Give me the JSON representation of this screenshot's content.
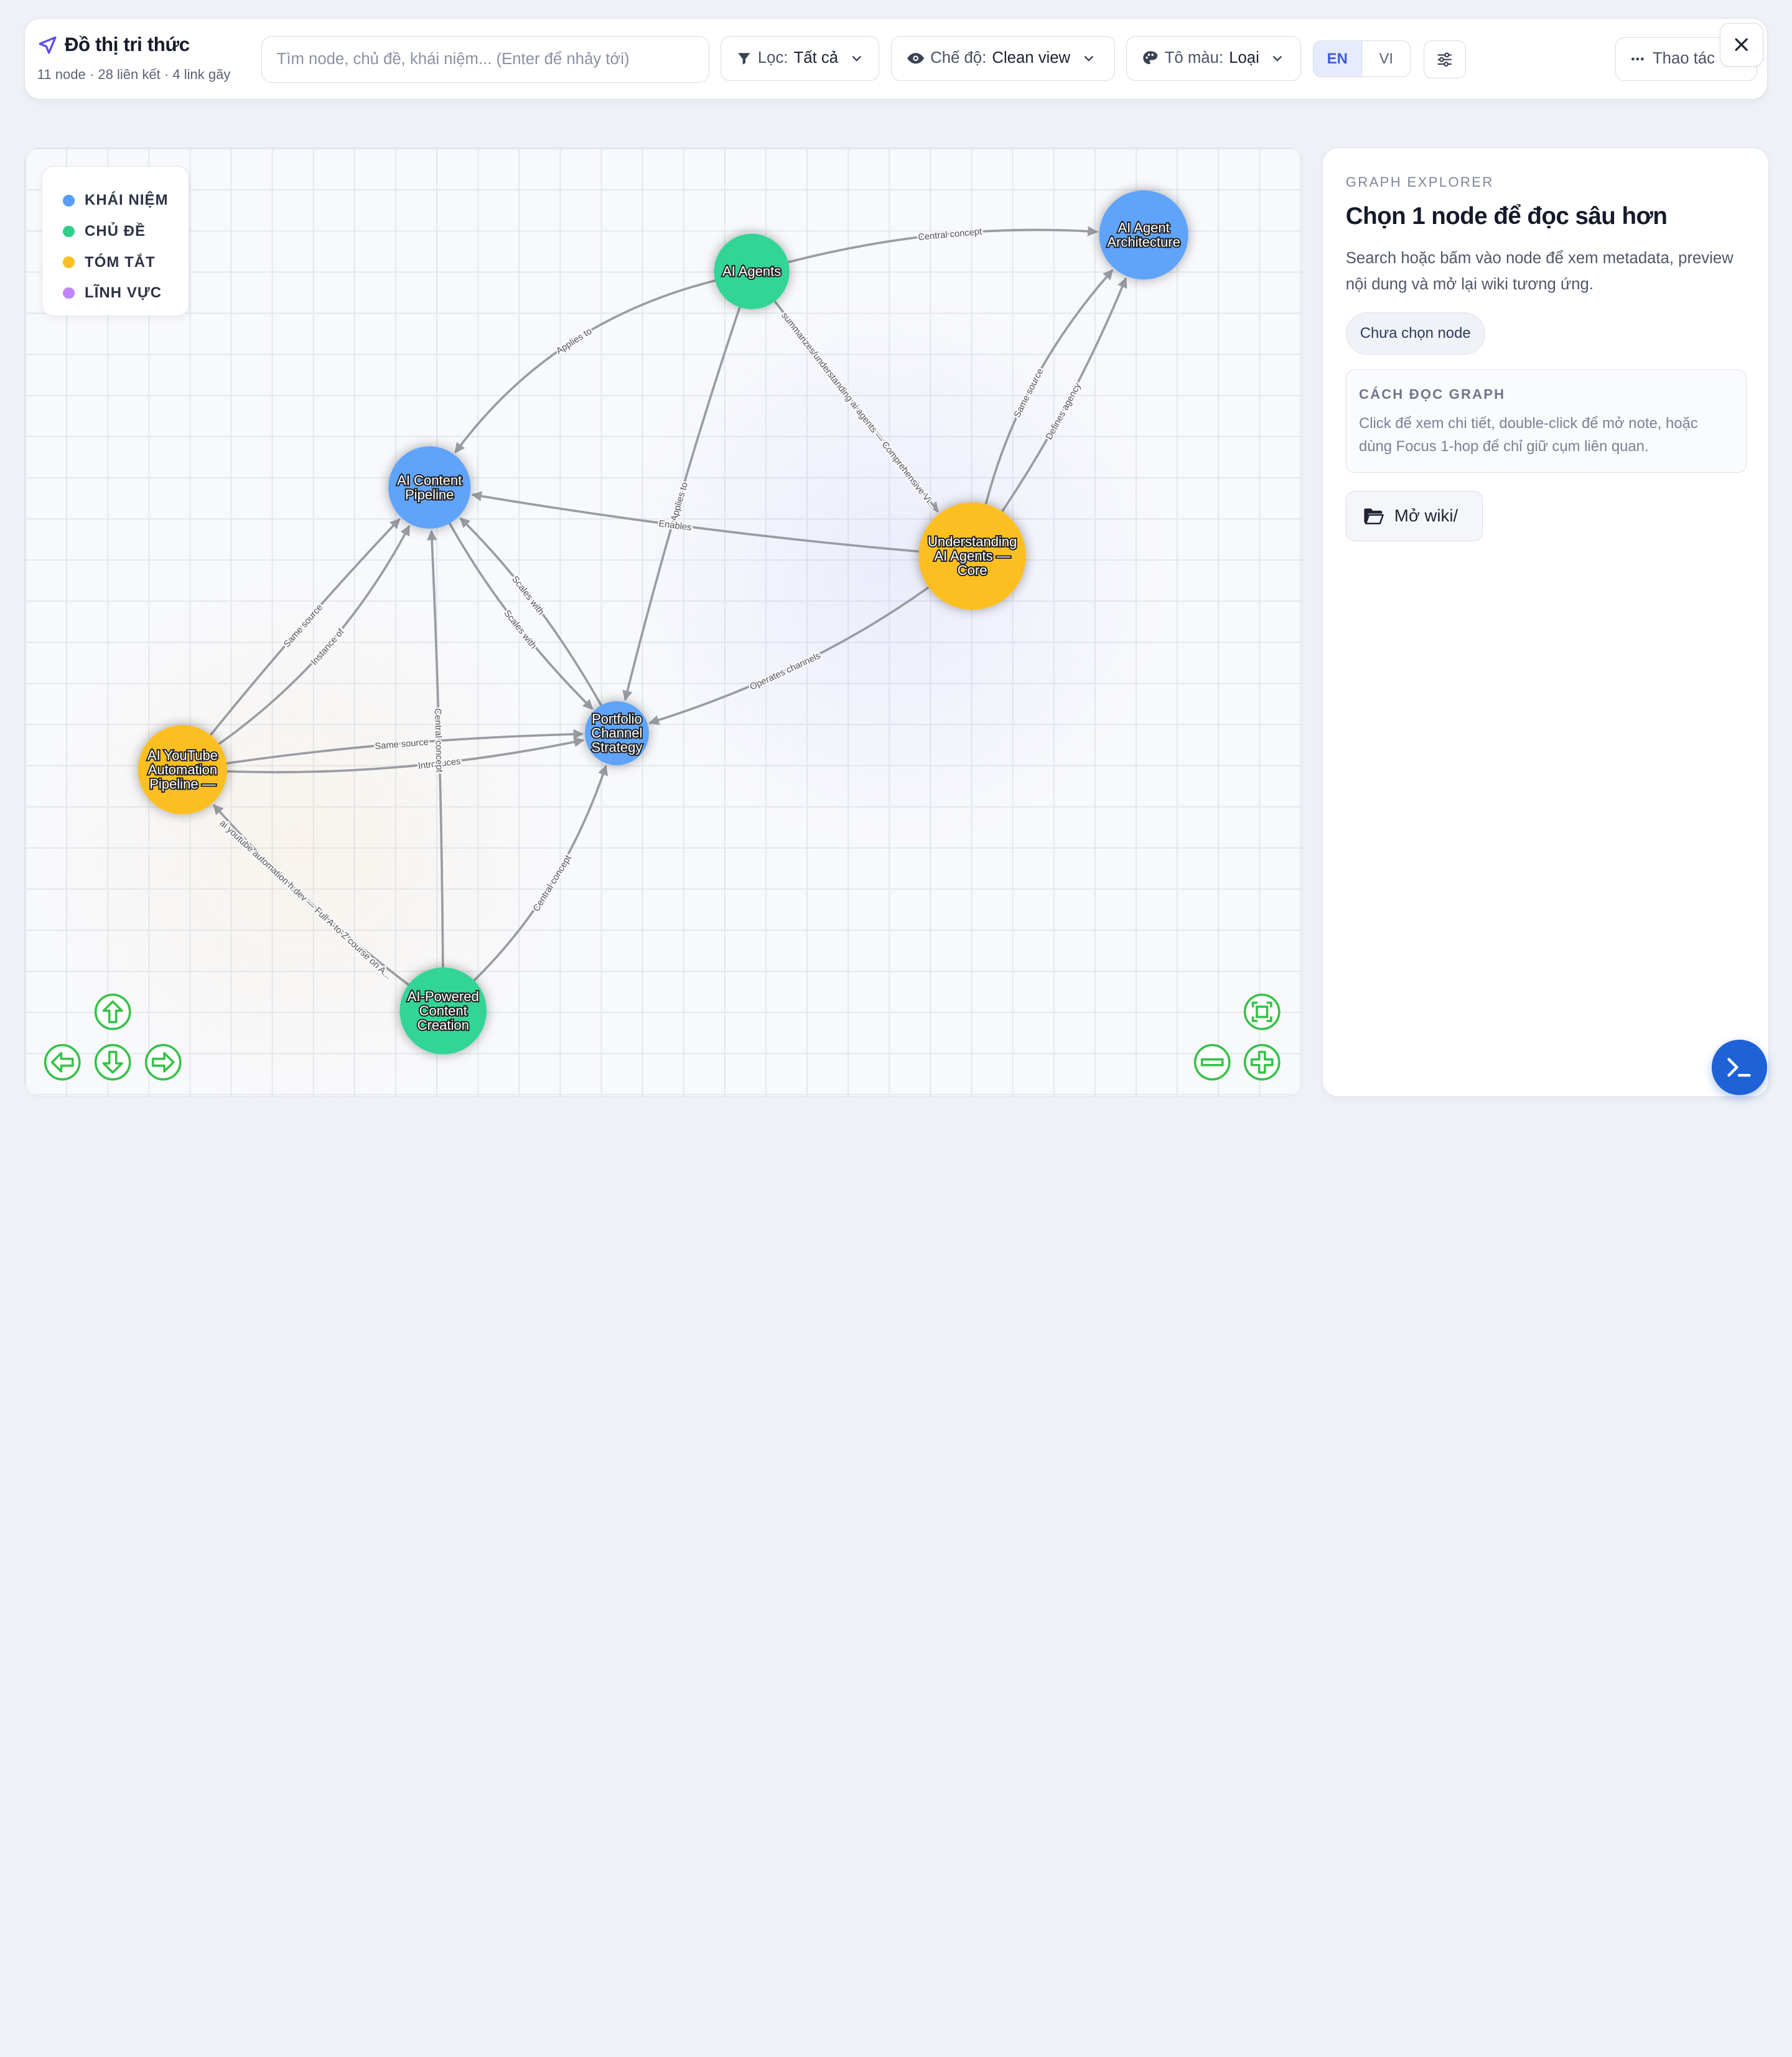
{
  "header": {
    "title": "Đồ thị tri thức",
    "stats": "11 node · 28 liên kết · 4 link gãy",
    "search_placeholder": "Tìm node, chủ đề, khái niệm... (Enter để nhảy tới)",
    "filter": {
      "label": "Lọc:",
      "value": "Tất cả"
    },
    "mode": {
      "label": "Chế độ:",
      "value": "Clean view"
    },
    "color": {
      "label": "Tô màu:",
      "value": "Loại"
    },
    "lang": {
      "en": "EN",
      "vi": "VI",
      "active": "EN"
    },
    "actions_label": "Thao tác"
  },
  "legend": [
    {
      "label": "KHÁI NIỆM",
      "color": "#5b9df6"
    },
    {
      "label": "CHỦ ĐỀ",
      "color": "#2fcf8b"
    },
    {
      "label": "TÓM TẮT",
      "color": "#fbbf24"
    },
    {
      "label": "LĨNH VỰC",
      "color": "#c084fc"
    }
  ],
  "graph": {
    "nodes": [
      {
        "id": "ai_agents",
        "lines": [
          "AI Agents"
        ],
        "type": "topic"
      },
      {
        "id": "arch",
        "lines": [
          "AI Agent",
          "Architecture"
        ],
        "type": "concept"
      },
      {
        "id": "pipeline",
        "lines": [
          "AI Content",
          "Pipeline"
        ],
        "type": "concept"
      },
      {
        "id": "understanding",
        "lines": [
          "Understanding",
          "AI Agents —",
          "Core"
        ],
        "type": "summary"
      },
      {
        "id": "portfolio",
        "lines": [
          "Portfolio",
          "Channel",
          "Strategy"
        ],
        "type": "concept"
      },
      {
        "id": "yt",
        "lines": [
          "AI YouTube",
          "Automation",
          "Pipeline —"
        ],
        "type": "summary"
      },
      {
        "id": "powered",
        "lines": [
          "AI-Powered",
          "Content",
          "Creation"
        ],
        "type": "topic"
      }
    ],
    "edges": [
      {
        "from": "ai_agents",
        "to": "arch",
        "label": "Central concept"
      },
      {
        "from": "ai_agents",
        "to": "pipeline",
        "label": "Applies to"
      },
      {
        "from": "ai_agents",
        "to": "understanding",
        "label": "summarizes/understanding ai agents — Comprehensive Vi..."
      },
      {
        "from": "ai_agents",
        "to": "portfolio",
        "label": "Applies to"
      },
      {
        "from": "understanding",
        "to": "arch",
        "label": "Defines agency"
      },
      {
        "from": "understanding",
        "to": "arch",
        "label": "Same source"
      },
      {
        "from": "understanding",
        "to": "pipeline",
        "label": "Enables"
      },
      {
        "from": "understanding",
        "to": "portfolio",
        "label": "Operates channels"
      },
      {
        "from": "pipeline",
        "to": "portfolio",
        "label": "Scales with"
      },
      {
        "from": "portfolio",
        "to": "pipeline",
        "label": "Scales with"
      },
      {
        "from": "yt",
        "to": "pipeline",
        "label": "Instance of"
      },
      {
        "from": "yt",
        "to": "pipeline",
        "label": "Same source"
      },
      {
        "from": "yt",
        "to": "portfolio",
        "label": "Same source"
      },
      {
        "from": "yt",
        "to": "portfolio",
        "label": "Introduces"
      },
      {
        "from": "powered",
        "to": "pipeline",
        "label": "Central concept"
      },
      {
        "from": "powered",
        "to": "portfolio",
        "label": "Central concept"
      },
      {
        "from": "powered",
        "to": "yt",
        "label": "ai youtube automation h.dev — Full A-to-Z course on A..."
      }
    ]
  },
  "panel": {
    "eyebrow": "GRAPH EXPLORER",
    "title": "Chọn 1 node để đọc sâu hơn",
    "description": "Search hoặc bấm vào node để xem metadata, preview nội dung và mở lại wiki tương ứng.",
    "chip": "Chưa chọn node",
    "howto_title": "CÁCH ĐỌC GRAPH",
    "howto_text": "Click để xem chi tiết, double-click để mở note, hoặc dùng Focus 1-hop để chỉ giữ cụm liên quan.",
    "open_label": "Mở wiki/"
  },
  "colors": {
    "concept": "#5ea3fb",
    "topic": "#33d595",
    "summary": "#fcbf24",
    "domain": "#c084fc",
    "nav_green": "#39c14b",
    "edge": "#9a9ca3"
  },
  "icons": {
    "brand": "send-icon",
    "filter": "funnel-icon",
    "mode": "eye-icon",
    "color": "palette-icon",
    "tune": "sliders-icon",
    "actions": "ellipsis-icon",
    "close": "close-icon",
    "open": "folder-icon",
    "terminal": "terminal-icon"
  }
}
